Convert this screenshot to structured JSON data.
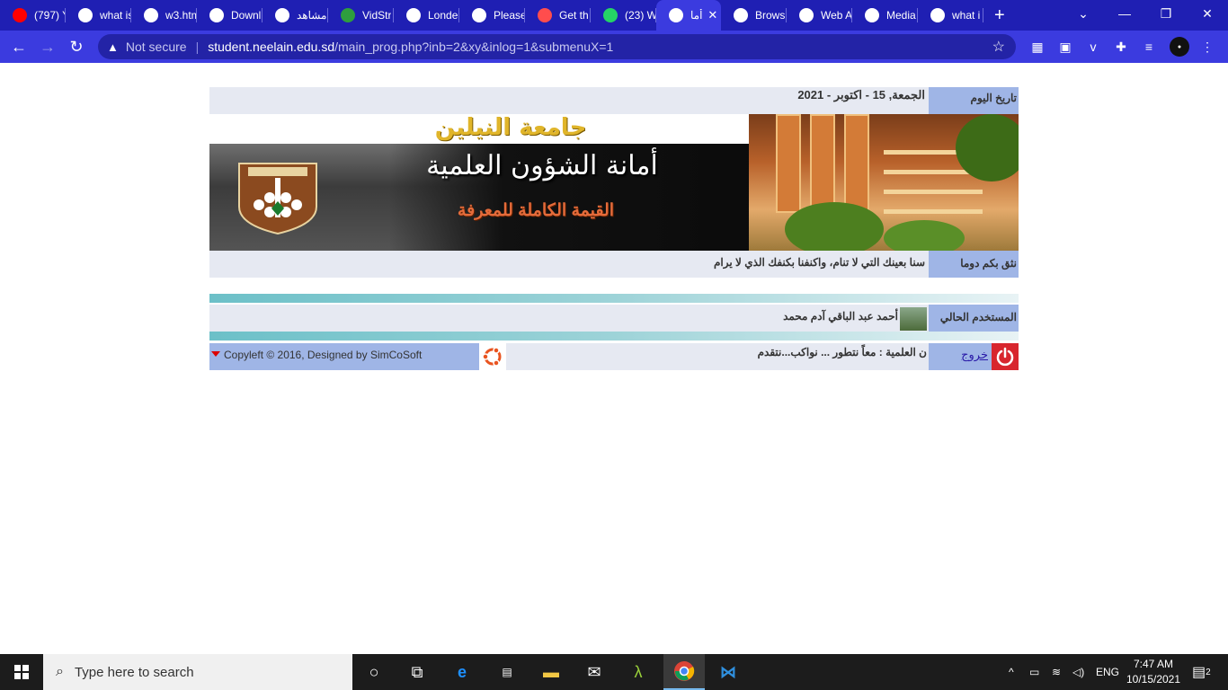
{
  "browser": {
    "tabs": [
      {
        "title": "(797) Y",
        "icon": "youtube-icon",
        "color": "#ff0000"
      },
      {
        "title": "what is",
        "icon": "google-icon",
        "color": "#ffffff"
      },
      {
        "title": "w3.htm",
        "icon": "globe-icon",
        "color": "#ffffff"
      },
      {
        "title": "Downl",
        "icon": "download-icon",
        "color": "#ffffff"
      },
      {
        "title": "مشاهد",
        "icon": "site-icon",
        "color": "#ffffff"
      },
      {
        "title": "VidStr",
        "icon": "vidstream-icon",
        "color": "#2e9e3e"
      },
      {
        "title": "Londe",
        "icon": "globe-icon",
        "color": "#ffffff"
      },
      {
        "title": "Please",
        "icon": "globe-icon",
        "color": "#ffffff"
      },
      {
        "title": "Get th",
        "icon": "link-icon",
        "color": "#ff4d4d"
      },
      {
        "title": "(23) W",
        "icon": "whatsapp-icon",
        "color": "#25d366"
      },
      {
        "title": "أما",
        "icon": "globe-icon",
        "color": "#ffffff",
        "active": true
      },
      {
        "title": "Brows",
        "icon": "medium-icon",
        "color": "#ffffff"
      },
      {
        "title": "Web A",
        "icon": "graduation-cap-icon",
        "color": "#ffffff"
      },
      {
        "title": "Media",
        "icon": "graduation-cap-icon",
        "color": "#ffffff"
      },
      {
        "title": "what i",
        "icon": "google-icon",
        "color": "#ffffff"
      }
    ],
    "new_tab": "+",
    "security_label": "Not secure",
    "url_host": "student.neelain.edu.sd",
    "url_path": "/main_prog.php?inb=2&xy&inlog=1&submenuX=1"
  },
  "page": {
    "date_label": "تاريخ اليوم",
    "date_value": "الجمعة, 15 - اكتوبر - 2021",
    "banner": {
      "university": "جامعة النيلين",
      "title": "أمانة الشؤون العلمية",
      "subtitle": "القيمة الكاملة للمعرفة"
    },
    "motto_label": "نثق بكم دوما",
    "motto_value": "سنا بعينك التي لا تنام، واكنفنا بكنفك الذي لا يرام",
    "user_label": "المستخدم الحالي",
    "user_name": "أحمد عبد الباقي آدم محمد",
    "copyright": "Copyleft © 2016, Designed by SimCoSoft",
    "ticker": "ن العلمية : معاً نتطور ... نواكب...نتقدم",
    "logout": "خروج"
  },
  "taskbar": {
    "search_placeholder": "Type here to search",
    "language": "ENG",
    "time": "7:47 AM",
    "date": "10/15/2021",
    "notifications": "2"
  }
}
